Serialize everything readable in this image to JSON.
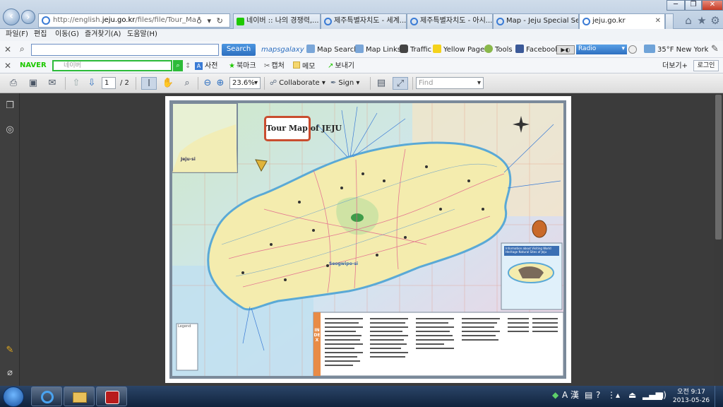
{
  "browser": {
    "url_prefix": "http://english.",
    "url_domain": "jeju.go.kr",
    "url_rest": "/files/file/Tour_Map_Englisl",
    "url_tools": "♁ ▾ ↻ ✕",
    "tabs": [
      {
        "label": "네이버 :: 나의 경쟁력,...",
        "icon": "naver-tab-icon",
        "color": "#1ec800"
      },
      {
        "label": "제주특별자치도 - 세계...",
        "icon": "ie-tab-icon",
        "color": "#3a7bd5"
      },
      {
        "label": "제주특별자치도 - 아시...",
        "icon": "ie-tab-icon",
        "color": "#3a7bd5"
      },
      {
        "label": "Map - Jeju Special Self...",
        "icon": "ie-tab-icon",
        "color": "#3a7bd5"
      },
      {
        "label": "jeju.go.kr",
        "icon": "ie-tab-icon",
        "color": "#3a7bd5",
        "active": true
      }
    ],
    "window_buttons": [
      "─",
      "❐",
      "✕"
    ]
  },
  "menu": [
    "파일(F)",
    "편집",
    "이동(G)",
    "즐겨찾기(A)",
    "도움말(H)"
  ],
  "toolbar1": {
    "search_button": "Search",
    "brand": "mapsgalaxy",
    "links": [
      "Map Search",
      "Map Links",
      "Traffic",
      "Yellow Pages",
      "Tools",
      "Facebook"
    ],
    "radio_label": "Radio",
    "weather": "35°F New York"
  },
  "toolbar2": {
    "brand": "NAVER",
    "search_placeholder": "네이버",
    "items": [
      "사전",
      "북마크",
      "캡처",
      "메모",
      "보내기"
    ],
    "more": "더보기+",
    "login": "로그인"
  },
  "pdf": {
    "current_page": "1",
    "total_pages": "/ 2",
    "zoom": "23.6%",
    "collaborate": "Collaborate",
    "sign": "Sign",
    "find_placeholder": "Find"
  },
  "map": {
    "title": "Tour Map of JEJU",
    "inset_label": "Jeju-si",
    "city_label": "Seogwipo-si",
    "index_label": "INDEX",
    "legend_label": "Legend",
    "info_title": "Information about Visiting World Heritage Natural Sites of Jeju"
  },
  "taskbar": {
    "time": "오전 9:17",
    "date": "2013-05-26",
    "ime": "A 漢"
  },
  "colors": {
    "sea": "#bfe0f0",
    "land": "#f5ecae",
    "accent": "#2d6fc0",
    "naver": "#1ec800"
  }
}
